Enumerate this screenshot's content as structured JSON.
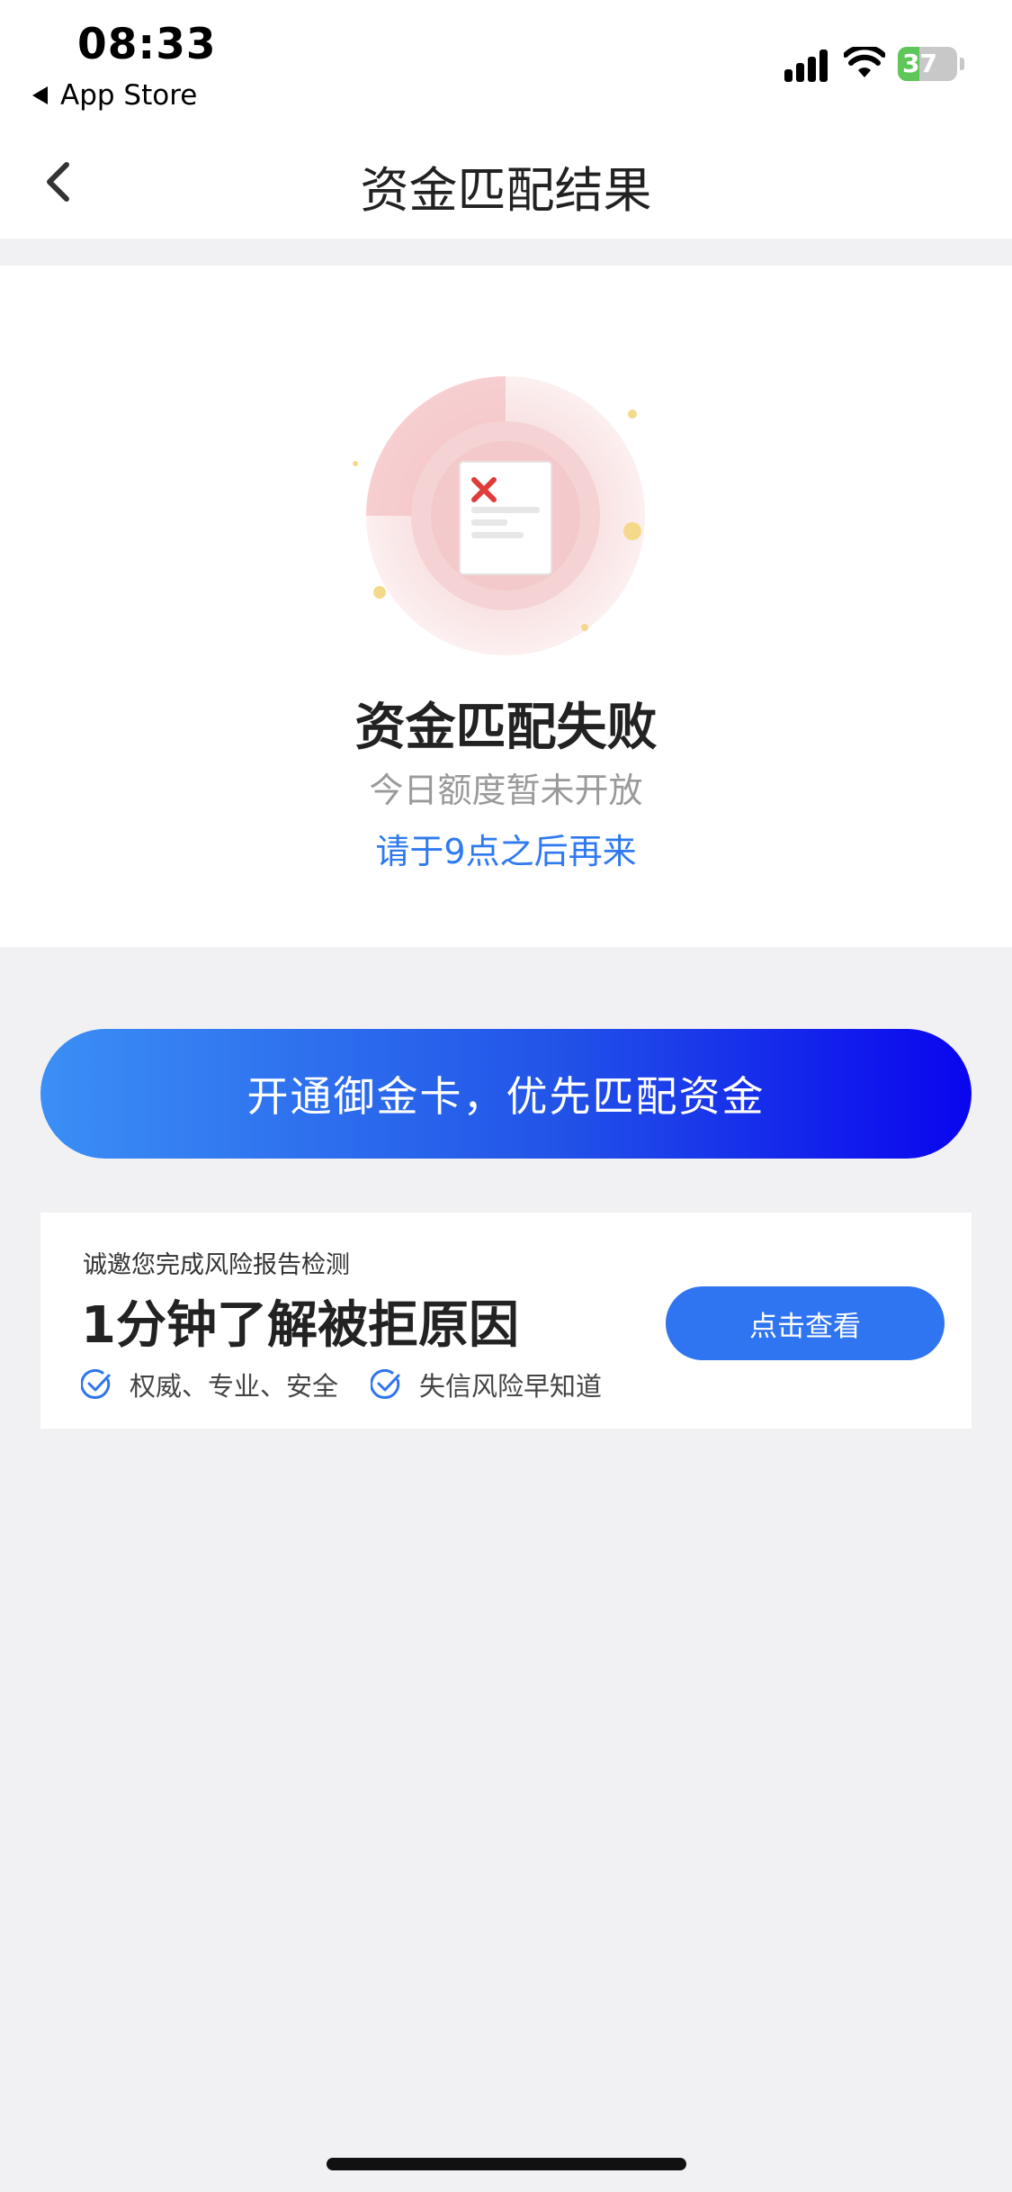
{
  "status_bar": {
    "time": "08:33",
    "back_app_label": "App Store",
    "battery_level": "37",
    "icons": [
      "signal-icon",
      "wifi-icon",
      "battery-icon",
      "back-triangle-icon"
    ]
  },
  "nav": {
    "title": "资金匹配结果",
    "back_icon": "chevron-left-icon"
  },
  "result": {
    "illustration_icon": "document-failed-icon",
    "title": "资金匹配失败",
    "subtitle": "今日额度暂未开放",
    "tip": "请于9点之后再来"
  },
  "cta": {
    "label": "开通御金卡，优先匹配资金",
    "gradient_start": "#3b8ff5",
    "gradient_end": "#0a05ee"
  },
  "promo": {
    "invite": "诚邀您完成风险报告检测",
    "headline": "1分钟了解被拒原因",
    "features": [
      "权威、专业、安全",
      "失信风险早知道"
    ],
    "feature_icon": "check-circle-icon",
    "button_label": "点击查看",
    "accent": "#2f74f0"
  }
}
